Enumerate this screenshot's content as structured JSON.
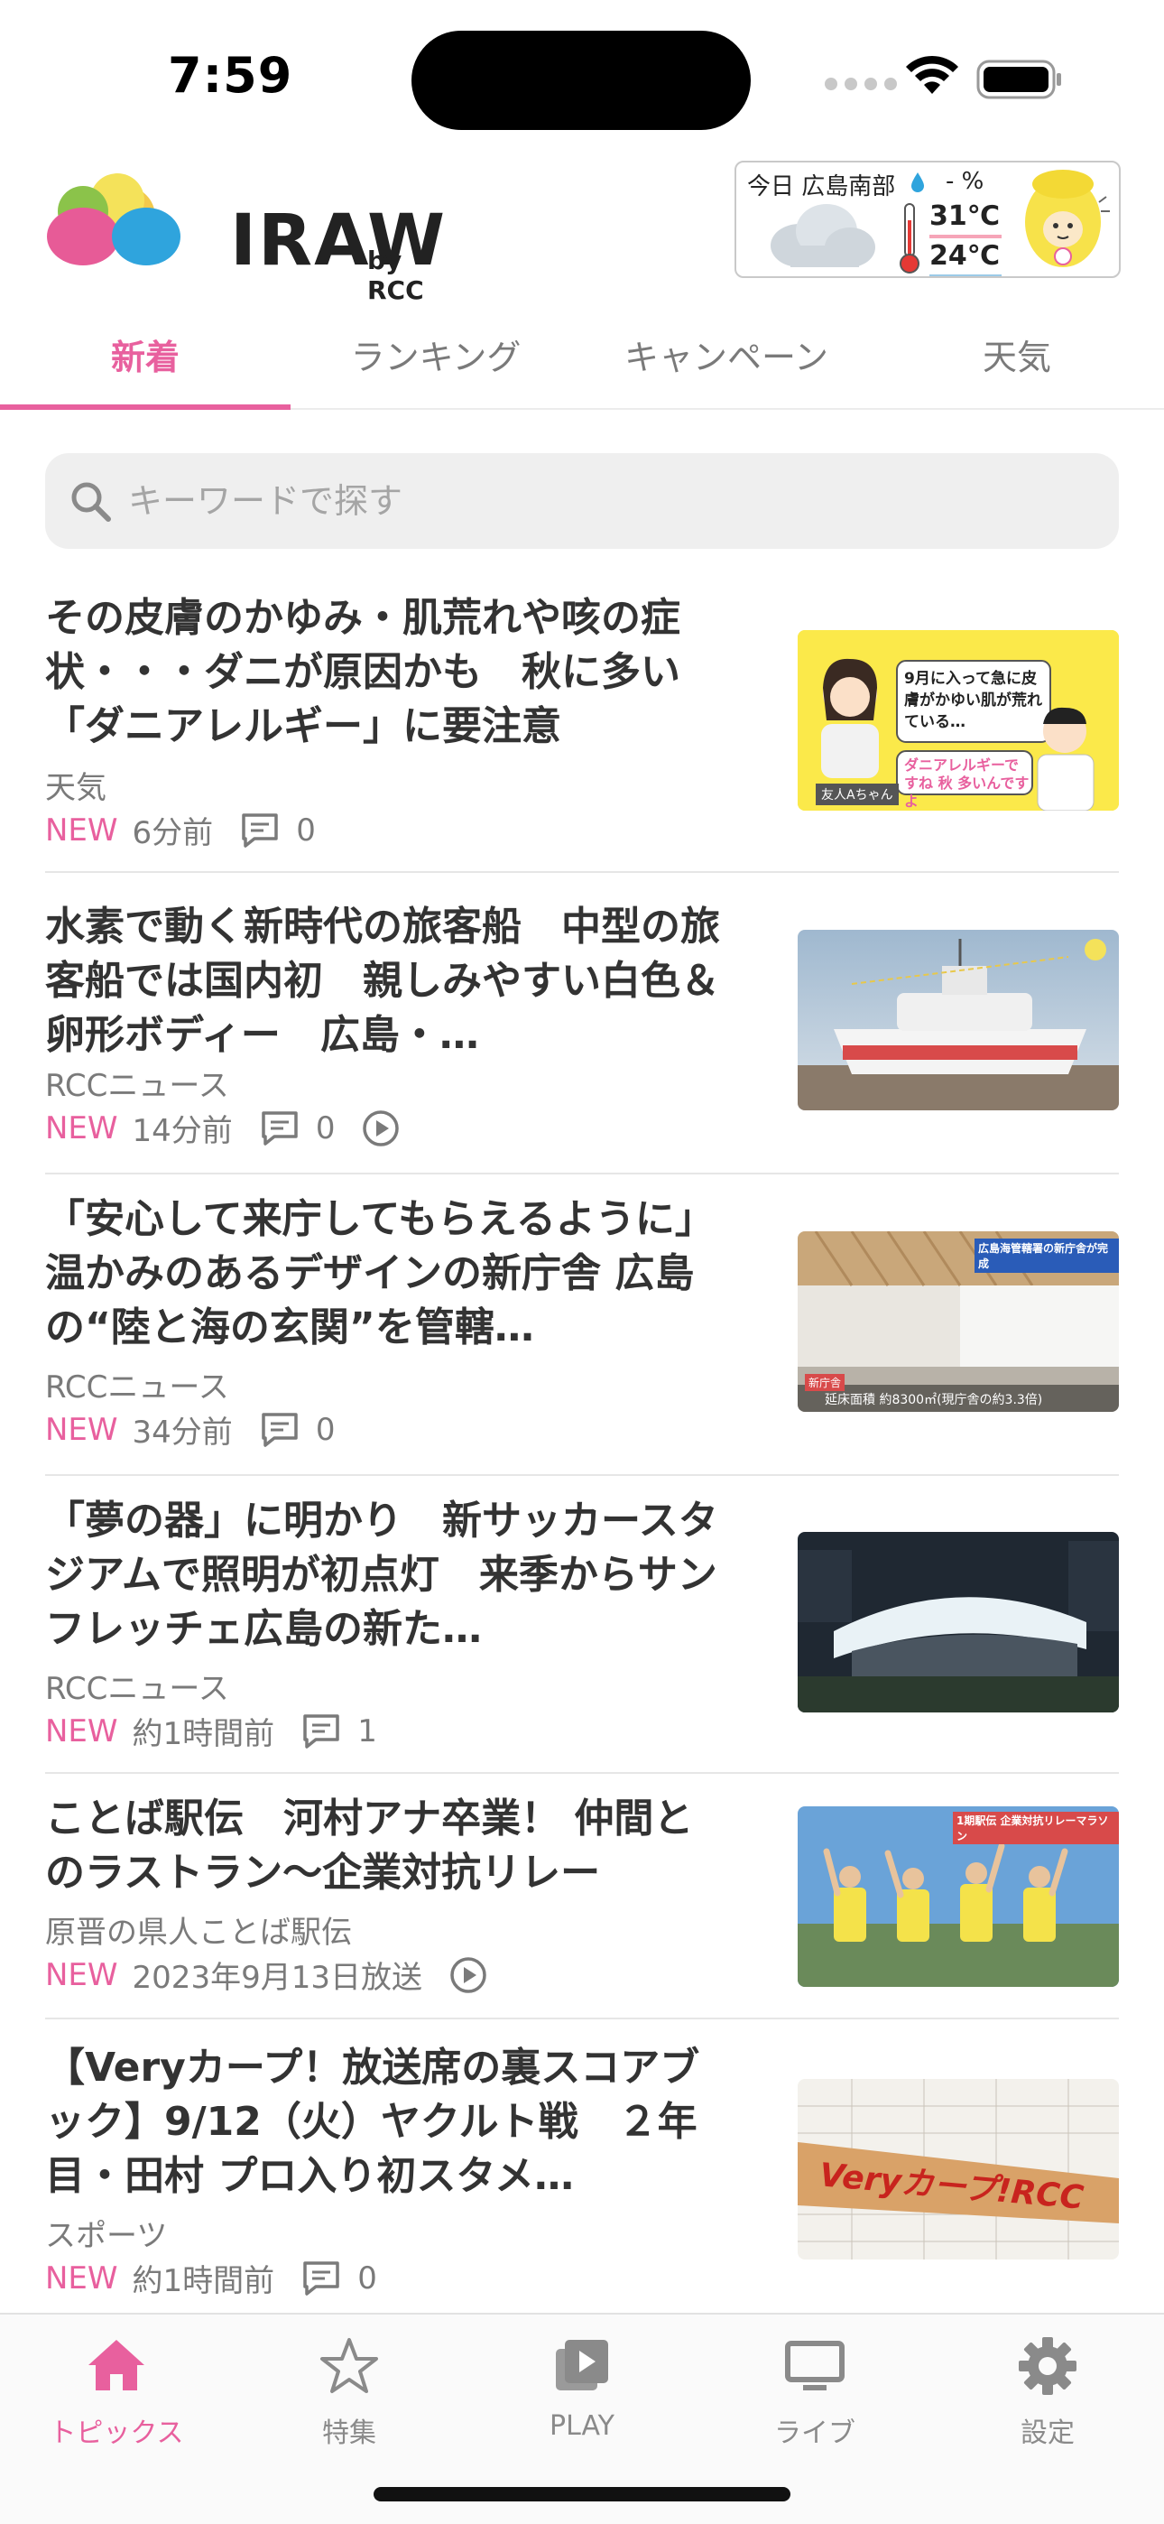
{
  "status": {
    "time": "7:59"
  },
  "header": {
    "logo_text": "IRAW",
    "logo_sub": "by RCC",
    "weather": {
      "label": "今日 広島南部",
      "rain": "- %",
      "high": "31℃",
      "low": "24℃"
    }
  },
  "tabs": [
    {
      "label": "新着",
      "active": true
    },
    {
      "label": "ランキング",
      "active": false
    },
    {
      "label": "キャンペーン",
      "active": false
    },
    {
      "label": "天気",
      "active": false
    }
  ],
  "search": {
    "placeholder": "キーワードで探す"
  },
  "articles": [
    {
      "title": "その皮膚のかゆみ・肌荒れや咳の症状・・・ダニが原因かも　秋に多い「ダニアレルギー」に要注意",
      "source": "天気",
      "new": "NEW",
      "time": "6分前",
      "comments": "0",
      "has_video": false,
      "thumb": "allergy-illustration"
    },
    {
      "title": "水素で動く新時代の旅客船　中型の旅客船では国内初　親しみやすい白色＆卵形ボディー　広島・…",
      "source": "RCCニュース",
      "new": "NEW",
      "time": "14分前",
      "comments": "0",
      "has_video": true,
      "thumb": "ship-photo"
    },
    {
      "title": "「安心して来庁してもらえるように」温かみのあるデザインの新庁舎 広島の“陸と海の玄関”を管轄…",
      "source": "RCCニュース",
      "new": "NEW",
      "time": "34分前",
      "comments": "0",
      "has_video": false,
      "thumb": "office-interior-photo"
    },
    {
      "title": "「夢の器」に明かり　新サッカースタジアムで照明が初点灯　来季からサンフレッチェ広島の新た…",
      "source": "RCCニュース",
      "new": "NEW",
      "time": "約1時間前",
      "comments": "1",
      "has_video": false,
      "thumb": "stadium-night-photo"
    },
    {
      "title": "ことば駅伝　河村アナ卒業！ 仲間とのラストラン～企業対抗リレー",
      "source": "原晋の県人ことば駅伝",
      "new": "NEW",
      "time": "2023年9月13日放送",
      "comments": null,
      "has_video": true,
      "thumb": "relay-runners-photo"
    },
    {
      "title": "【Veryカープ！放送席の裏スコアブック】9/12（火）ヤクルト戦　２年目・田村 プロ入り初スタメ…",
      "source": "スポーツ",
      "new": "NEW",
      "time": "約1時間前",
      "comments": "0",
      "has_video": false,
      "thumb": "bat-scorebook-photo"
    }
  ],
  "thumb_texts": {
    "allergy_bubble1": "9月に入って急に皮膚がかゆい肌が荒れている…",
    "allergy_bubble2": "ダニアレルギーですね 秋 多いんですよ",
    "allergy_name": "友人Aちゃん",
    "office_caption": "広島海管轄署の新庁舎が完成",
    "office_bottom": "延床面積 約8300㎡(現庁舎の約3.3倍)",
    "office_tag": "新庁舎",
    "relay_caption": "1期駅伝 企業対抗リレーマラソン",
    "bat_text": "Veryカープ!RCC"
  },
  "bottom_nav": [
    {
      "label": "トピックス",
      "icon": "home-icon",
      "active": true
    },
    {
      "label": "特集",
      "icon": "star-icon",
      "active": false
    },
    {
      "label": "PLAY",
      "icon": "play-icon",
      "active": false
    },
    {
      "label": "ライブ",
      "icon": "tv-icon",
      "active": false
    },
    {
      "label": "設定",
      "icon": "gear-icon",
      "active": false
    }
  ],
  "colors": {
    "accent": "#e8609e",
    "text": "#333333",
    "muted": "#7a7a7a"
  }
}
